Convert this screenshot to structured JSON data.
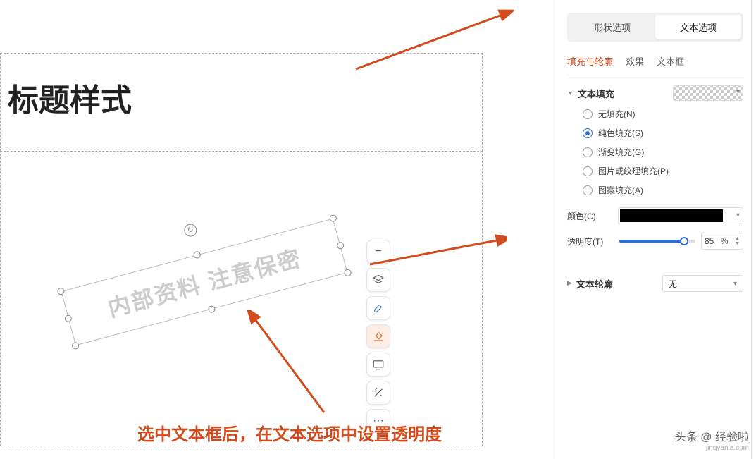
{
  "canvas": {
    "title": "标题样式",
    "watermark": "内部资料 注意保密"
  },
  "floatToolbar": {
    "minus": "−",
    "more": "···"
  },
  "panel": {
    "modeTabs": {
      "shape": "形状选项",
      "text": "文本选项"
    },
    "subTabs": {
      "fill": "填充与轮廓",
      "effect": "效果",
      "textbox": "文本框"
    },
    "textFill": {
      "header": "文本填充",
      "options": {
        "none": "无填充(N)",
        "solid": "纯色填充(S)",
        "gradient": "渐变填充(G)",
        "picture": "图片或纹理填充(P)",
        "pattern": "图案填充(A)"
      },
      "colorLabel": "颜色(C)",
      "opacityLabel": "透明度(T)",
      "opacityValue": "85",
      "opacityUnit": "%"
    },
    "textOutline": {
      "header": "文本轮廓",
      "value": "无"
    }
  },
  "annotation": "选中文本框后，在文本选项中设置透明度",
  "attribution": {
    "line1": "头条 @ 经验啦",
    "line2": "jingyanla.com"
  }
}
